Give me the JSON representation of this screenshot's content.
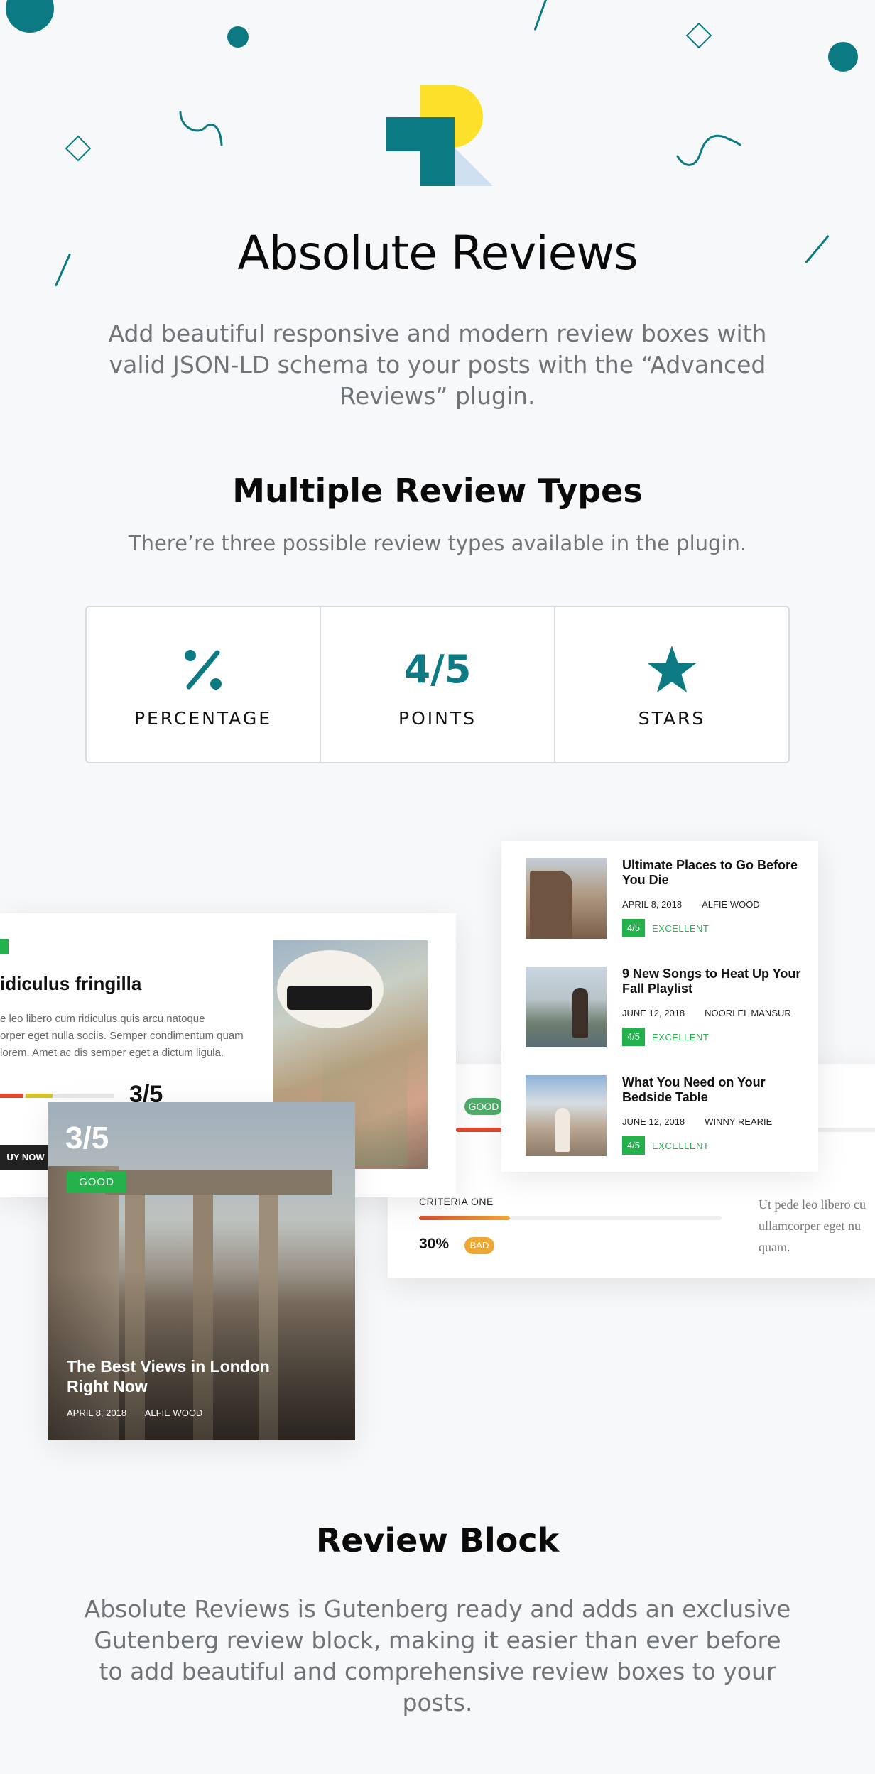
{
  "hero": {
    "title": "Absolute Reviews",
    "description": "Add beautiful responsive and modern review boxes with valid JSON-LD schema to your posts with the “Advanced Reviews” plugin."
  },
  "types_section": {
    "title": "Multiple Review Types",
    "subtitle": "There’re three possible review types available in the plugin.",
    "types": [
      {
        "icon": "percent-icon",
        "label": "PERCENTAGE"
      },
      {
        "icon": "points-icon",
        "label": "POINTS",
        "icon_text": "4/5"
      },
      {
        "icon": "star-icon",
        "label": "STARS"
      }
    ]
  },
  "demo": {
    "left_card": {
      "title": "idiculus fringilla",
      "text_lines": [
        "e leo libero cum ridiculus quis arcu natoque",
        "orper eget nulla sociis. Semper condimentum quam",
        "lorem. Amet ac dis semper eget a dictum ligula."
      ],
      "score": "3/5",
      "button": "UY NOW"
    },
    "feature_card": {
      "score": "3/5",
      "badge": "GOOD",
      "title": "The Best Views in London Right Now",
      "date": "APRIL 8, 2018",
      "author": "ALFIE WOOD"
    },
    "criteria_card": {
      "badge_top": "GOOD",
      "criteria_label": "CRITERIA ONE",
      "percent": "30%",
      "percent_value": 0.3,
      "badge": "BAD",
      "text_lines": [
        "Ut pede leo libero cu",
        "ullamcorper eget nu",
        "quam."
      ]
    },
    "list_card": {
      "items": [
        {
          "title": "Ultimate Places to Go Before You Die",
          "date": "APRIL 8, 2018",
          "author": "ALFIE WOOD",
          "score": "4/5",
          "rating": "EXCELLENT"
        },
        {
          "title": "9 New Songs to Heat Up Your Fall Playlist",
          "date": "JUNE 12, 2018",
          "author": "NOORI EL MANSUR",
          "score": "4/5",
          "rating": "EXCELLENT"
        },
        {
          "title": "What You Need on Your Bedside Table",
          "date": "JUNE 12, 2018",
          "author": "WINNY REARIE",
          "score": "4/5",
          "rating": "EXCELLENT"
        }
      ]
    }
  },
  "block_section": {
    "title": "Review Block",
    "description": "Absolute Reviews is Gutenberg ready and adds an exclusive Gutenberg review block, making it easier than ever before to add beautiful and comprehensive review boxes to your posts."
  },
  "colors": {
    "teal": "#0b7a83",
    "yellow": "#fde02a",
    "green": "#23b24b",
    "orange": "#f0a632"
  }
}
